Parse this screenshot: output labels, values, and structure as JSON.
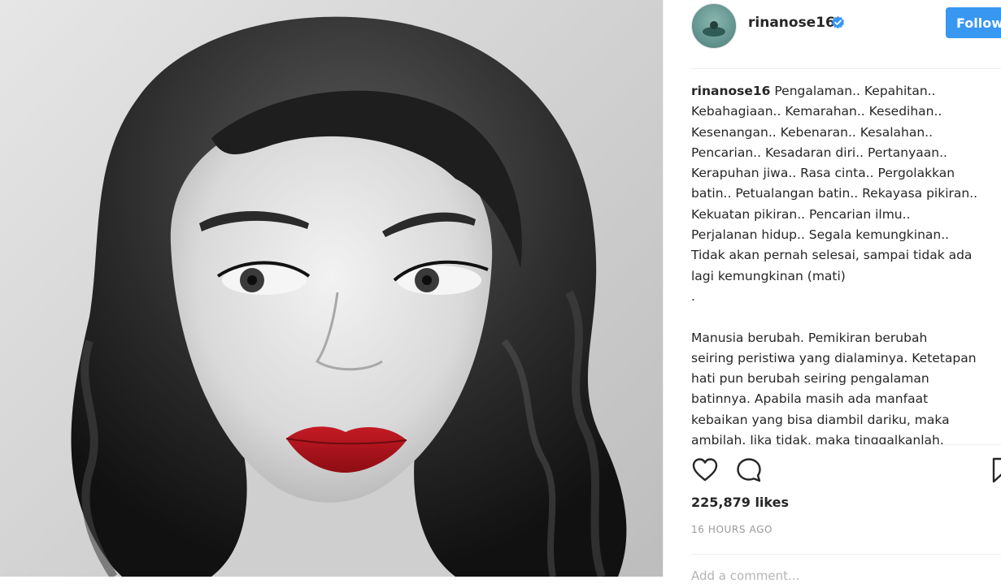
{
  "post": {
    "photo_alt": "portrait-photo",
    "accent_lip_color": "#b2141d"
  },
  "header": {
    "username": "rinanose16",
    "verified": true,
    "follow_label": "Follow",
    "follow_color": "#3897f0",
    "verified_color": "#3897f0"
  },
  "caption": {
    "username": "rinanose16",
    "lines": [
      "Pengalaman.. Kepahitan..",
      "Kebahagiaan.. Kemarahan.. Kesedihan..",
      "Kesenangan.. Kebenaran.. Kesalahan..",
      "Pencarian.. Kesadaran diri.. Pertanyaan..",
      "Kerapuhan jiwa.. Rasa cinta.. Pergolakkan",
      "batin.. Petualangan batin.. Rekayasa pikiran..",
      "Kekuatan pikiran.. Pencarian ilmu..",
      "Perjalanan hidup.. Segala kemungkinan..",
      "Tidak akan pernah selesai, sampai tidak ada",
      "lagi kemungkinan (mati)",
      ".",
      "",
      "Manusia berubah. Pemikiran berubah",
      "seiring peristiwa yang dialaminya. Ketetapan",
      "hati pun berubah seiring pengalaman",
      "batinnya. Apabila masih ada manfaat",
      "kebaikan yang bisa diambil dariku, maka",
      "ambilah. Jika tidak, maka tinggalkanlah."
    ]
  },
  "actions": {
    "like_icon": "heart-icon",
    "comment_icon": "comment-icon",
    "save_icon": "bookmark-icon"
  },
  "stats": {
    "likes": "225,879 likes",
    "timestamp": "16 HOURS AGO"
  },
  "comment_box": {
    "placeholder": "Add a comment..."
  }
}
